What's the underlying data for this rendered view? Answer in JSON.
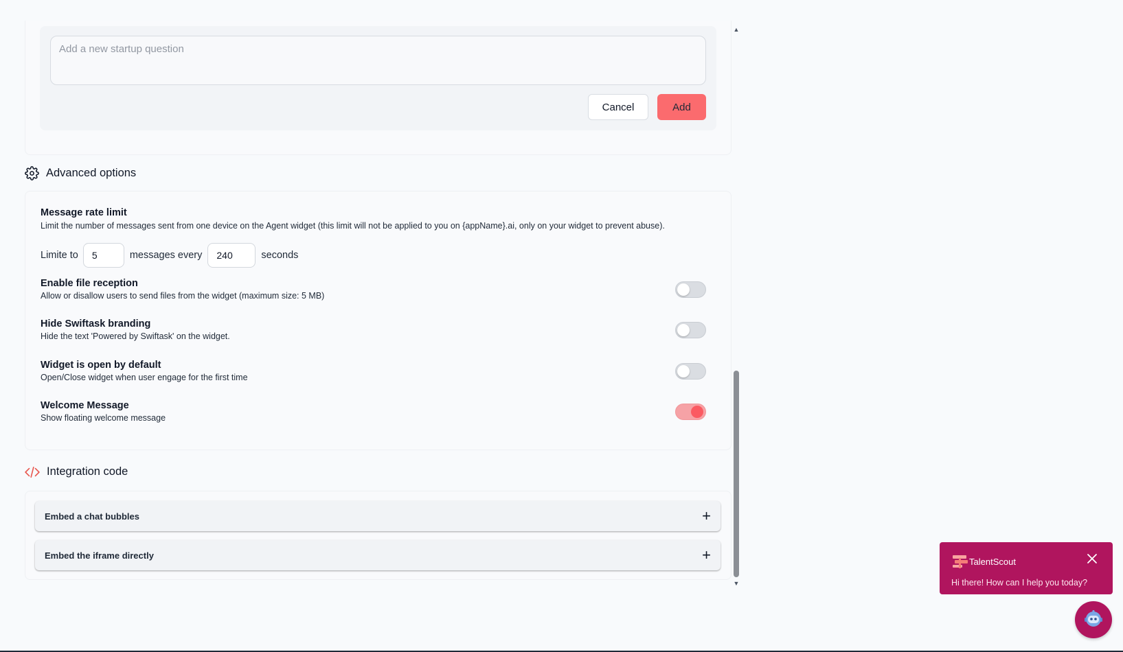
{
  "startup_question": {
    "placeholder": "Add a new startup question",
    "cancel_label": "Cancel",
    "add_label": "Add"
  },
  "advanced": {
    "title": "Advanced options",
    "rate_limit": {
      "title": "Message rate limit",
      "description": "Limit the number of messages sent from one device on the Agent widget (this limit will not be applied to you on {appName}.ai, only on your widget to prevent abuse).",
      "prefix": "Limite to",
      "messages_value": "5",
      "middle": "messages every",
      "seconds_value": "240",
      "suffix": "seconds"
    },
    "options": [
      {
        "title": "Enable file reception",
        "description": "Allow or disallow users to send files from the widget (maximum size: 5 MB)",
        "enabled": false
      },
      {
        "title": "Hide Swiftask branding",
        "description": "Hide the text 'Powered by Swiftask' on the widget.",
        "enabled": false
      },
      {
        "title": "Widget is open by default",
        "description": "Open/Close widget when user engage for the first time",
        "enabled": false
      },
      {
        "title": "Welcome Message",
        "description": "Show floating welcome message",
        "enabled": true
      }
    ]
  },
  "integration": {
    "title": "Integration code",
    "items": [
      {
        "label": "Embed a chat bubbles"
      },
      {
        "label": "Embed the iframe directly"
      }
    ]
  },
  "widget": {
    "name": "TalentScout",
    "message": "Hi there! How can I help you today?"
  },
  "colors": {
    "accent": "#fb6b6e",
    "widget": "#b0155e",
    "integration_icon": "#e8574f"
  },
  "icons": [
    "gear-icon",
    "code-icon",
    "chevron-up-icon",
    "chevron-down-icon",
    "plus-icon",
    "close-icon",
    "signpost-icon",
    "bot-icon"
  ]
}
